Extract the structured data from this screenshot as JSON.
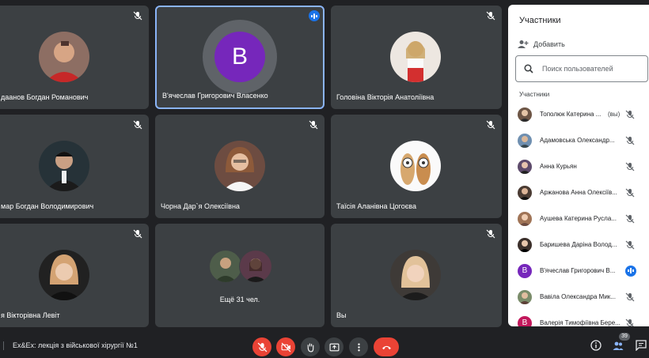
{
  "tiles": [
    {
      "name": "даанов Богдан Романович",
      "muted": true
    },
    {
      "name": "В'ячеслав Григорович Власенко",
      "letter": "В",
      "speaking": true
    },
    {
      "name": "Головіна Вікторія Анатоліївна",
      "muted": true
    },
    {
      "name": "мар Богдан Володимирович",
      "muted": true
    },
    {
      "name": "Чорна Дар`я Олексіївна",
      "muted": true
    },
    {
      "name": "Таїсія Аланівна Цогоєва",
      "muted": true
    },
    {
      "name": "я Вікторівна Левіт",
      "muted": true
    },
    {
      "more_label": "Ещё 31 чел.",
      "muted": false
    },
    {
      "name": "Вы",
      "muted": true
    }
  ],
  "bottombar": {
    "meeting_title": "Ex&Ex: лекція з військової хірургії №1",
    "participant_count": "39"
  },
  "panel": {
    "title": "Участники",
    "add_label": "Добавить",
    "search_placeholder": "Поиск пользователей",
    "section_label": "Участники",
    "participants": [
      {
        "name": "Тополюк Катерина ...",
        "you": "(вы)"
      },
      {
        "name": "Адамовська Олександр..."
      },
      {
        "name": "Анна Курьян"
      },
      {
        "name": "Аржанова Анна Олексіїв..."
      },
      {
        "name": "Аушева Катерина Русла..."
      },
      {
        "name": "Баришева Дарiна Волод..."
      },
      {
        "name": "В'ячеслав Григорович В...",
        "letter": "В",
        "speaking": true
      },
      {
        "name": "Вавіла Олександра Мик..."
      },
      {
        "name": "Валерія Тимофіївна Бере...",
        "letter": "В"
      }
    ]
  },
  "colors": {
    "accent": "#1a73e8",
    "danger": "#ea4335",
    "tile": "#3c4043",
    "avatar_purple": "#7627bb"
  }
}
